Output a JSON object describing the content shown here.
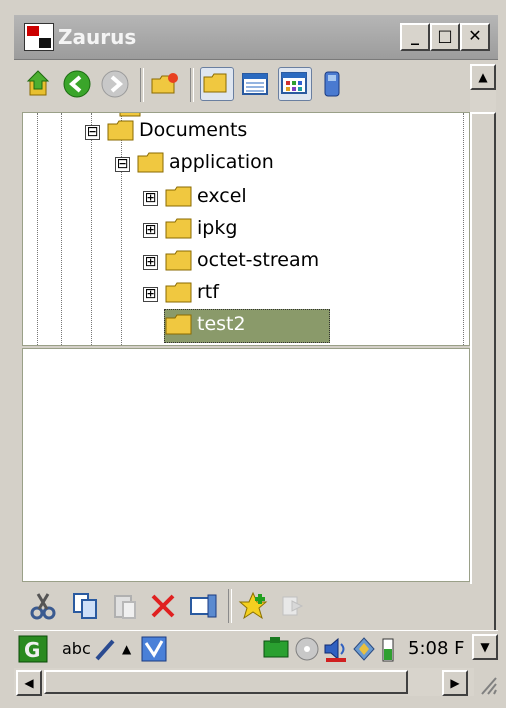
{
  "window": {
    "title": "Zaurus",
    "minimize_label": "_",
    "maximize_label": "□",
    "close_label": "✕"
  },
  "toolbar": {
    "buttons": [
      "up-folder-icon",
      "back-icon",
      "forward-icon",
      "new-folder-icon",
      "tree-view-icon",
      "detail-view-icon",
      "icon-view-icon",
      "drive-icon"
    ]
  },
  "tree": {
    "nodes": [
      {
        "label": "Documents",
        "expander": "⊟",
        "level": 1
      },
      {
        "label": "application",
        "expander": "⊟",
        "level": 2
      },
      {
        "label": "excel",
        "expander": "⊞",
        "level": 3
      },
      {
        "label": "ipkg",
        "expander": "⊞",
        "level": 3
      },
      {
        "label": "octet-stream",
        "expander": "⊞",
        "level": 3
      },
      {
        "label": "rtf",
        "expander": "⊞",
        "level": 3
      },
      {
        "label": "test2",
        "expander": "",
        "level": 3,
        "selected": true
      }
    ]
  },
  "bottom_toolbar": {
    "buttons": [
      "cut-icon",
      "copy-icon",
      "paste-icon",
      "delete-icon",
      "properties-icon",
      "bookmark-add-icon",
      "bookmark-go-icon"
    ]
  },
  "taskbar": {
    "input_method": "abc",
    "clock": "5:08 F"
  },
  "colors": {
    "selection": "#8a9a6a",
    "titlebar": "#a8a8a8",
    "chrome": "#d4d0c8"
  }
}
